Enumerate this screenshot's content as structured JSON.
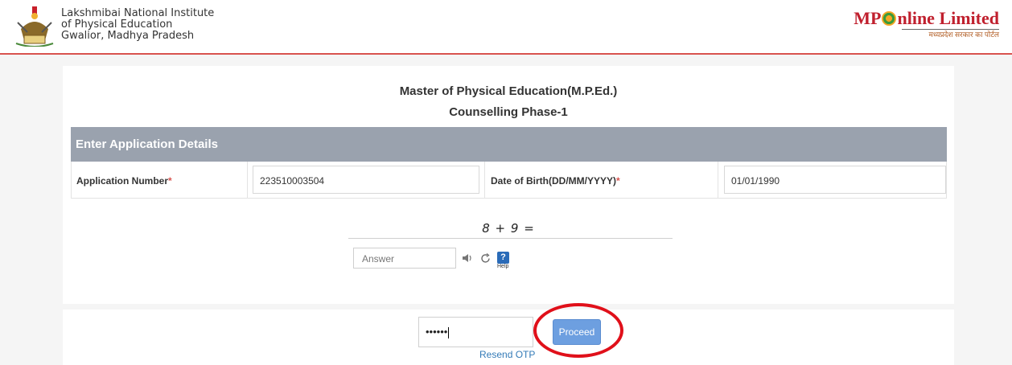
{
  "header": {
    "institute_name_line1": "Lakshmibai National Institute",
    "institute_name_line2": "of Physical Education",
    "institute_name_line3": "Gwalior, Madhya Pradesh",
    "brand_prefix": "MP",
    "brand_suffix": "nline Limited",
    "brand_tagline_hindi": "मध्यप्रदेश सरकार का पोर्टल",
    "brand_color": "#c0202e"
  },
  "form": {
    "title_line1": "Master of Physical Education(M.P.Ed.)",
    "title_line2": "Counselling Phase-1",
    "section_heading": "Enter Application Details",
    "application_number_label": "Application Number",
    "application_number_value": "223510003504",
    "dob_label": "Date of Birth(DD/MM/YYYY)",
    "dob_value": "01/01/1990",
    "required_marker": "*"
  },
  "captcha": {
    "question": "8 + 9 =",
    "answer_placeholder": "Answer",
    "audio_icon": "speaker-icon",
    "refresh_icon": "refresh-icon",
    "help_symbol": "?",
    "help_label": "Help"
  },
  "otp": {
    "masked_value": "••••••",
    "proceed_label": "Proceed",
    "resend_label": "Resend OTP",
    "button_color": "#6d9fe0",
    "highlight_color": "#e0101a"
  }
}
